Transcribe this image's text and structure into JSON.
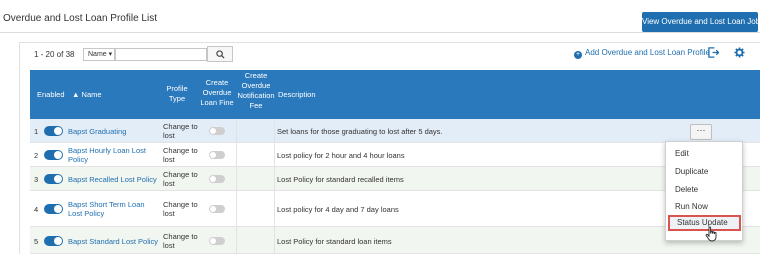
{
  "header": {
    "title": "Overdue and Lost Loan Profile List",
    "jobs_button": "View Overdue and Lost Loan Jobs"
  },
  "toolbar": {
    "count": "1 - 20 of 38",
    "sort_value": "Name",
    "search_value": "",
    "add_link": "Add Overdue and Lost Loan Profile"
  },
  "table": {
    "headers": {
      "enabled": "Enabled",
      "name": "Name",
      "profile_type": "Profile Type",
      "create_fine": "Create Overdue Loan Fine",
      "create_notif": "Create Overdue Notification Fee",
      "description": "Description"
    },
    "rows": [
      {
        "num": "1",
        "name": "Bapst Graduating",
        "type": "Change to lost",
        "description": "Set loans for those graduating to lost after 5 days."
      },
      {
        "num": "2",
        "name": "Bapst Hourly Loan Lost Policy",
        "type": "Change to lost",
        "description": "Lost policy for 2 hour and 4 hour loans"
      },
      {
        "num": "3",
        "name": "Bapst Recalled Lost Policy",
        "type": "Change to lost",
        "description": "Lost Policy for standard recalled items"
      },
      {
        "num": "4",
        "name": "Bapst Short Term Loan Lost Policy",
        "type": "Change to lost",
        "description": "Lost policy for 4 day and 7 day loans"
      },
      {
        "num": "5",
        "name": "Bapst Standard Lost Policy",
        "type": "Change to lost",
        "description": "Lost Policy for standard loan items"
      }
    ]
  },
  "row_menu": {
    "more": "···",
    "items": [
      "Edit",
      "Duplicate",
      "Delete",
      "Run Now",
      "Status Update"
    ]
  },
  "colors": {
    "accent": "#1f6fb0",
    "header_bg": "#2a79bd",
    "highlight_border": "#d9534f"
  }
}
